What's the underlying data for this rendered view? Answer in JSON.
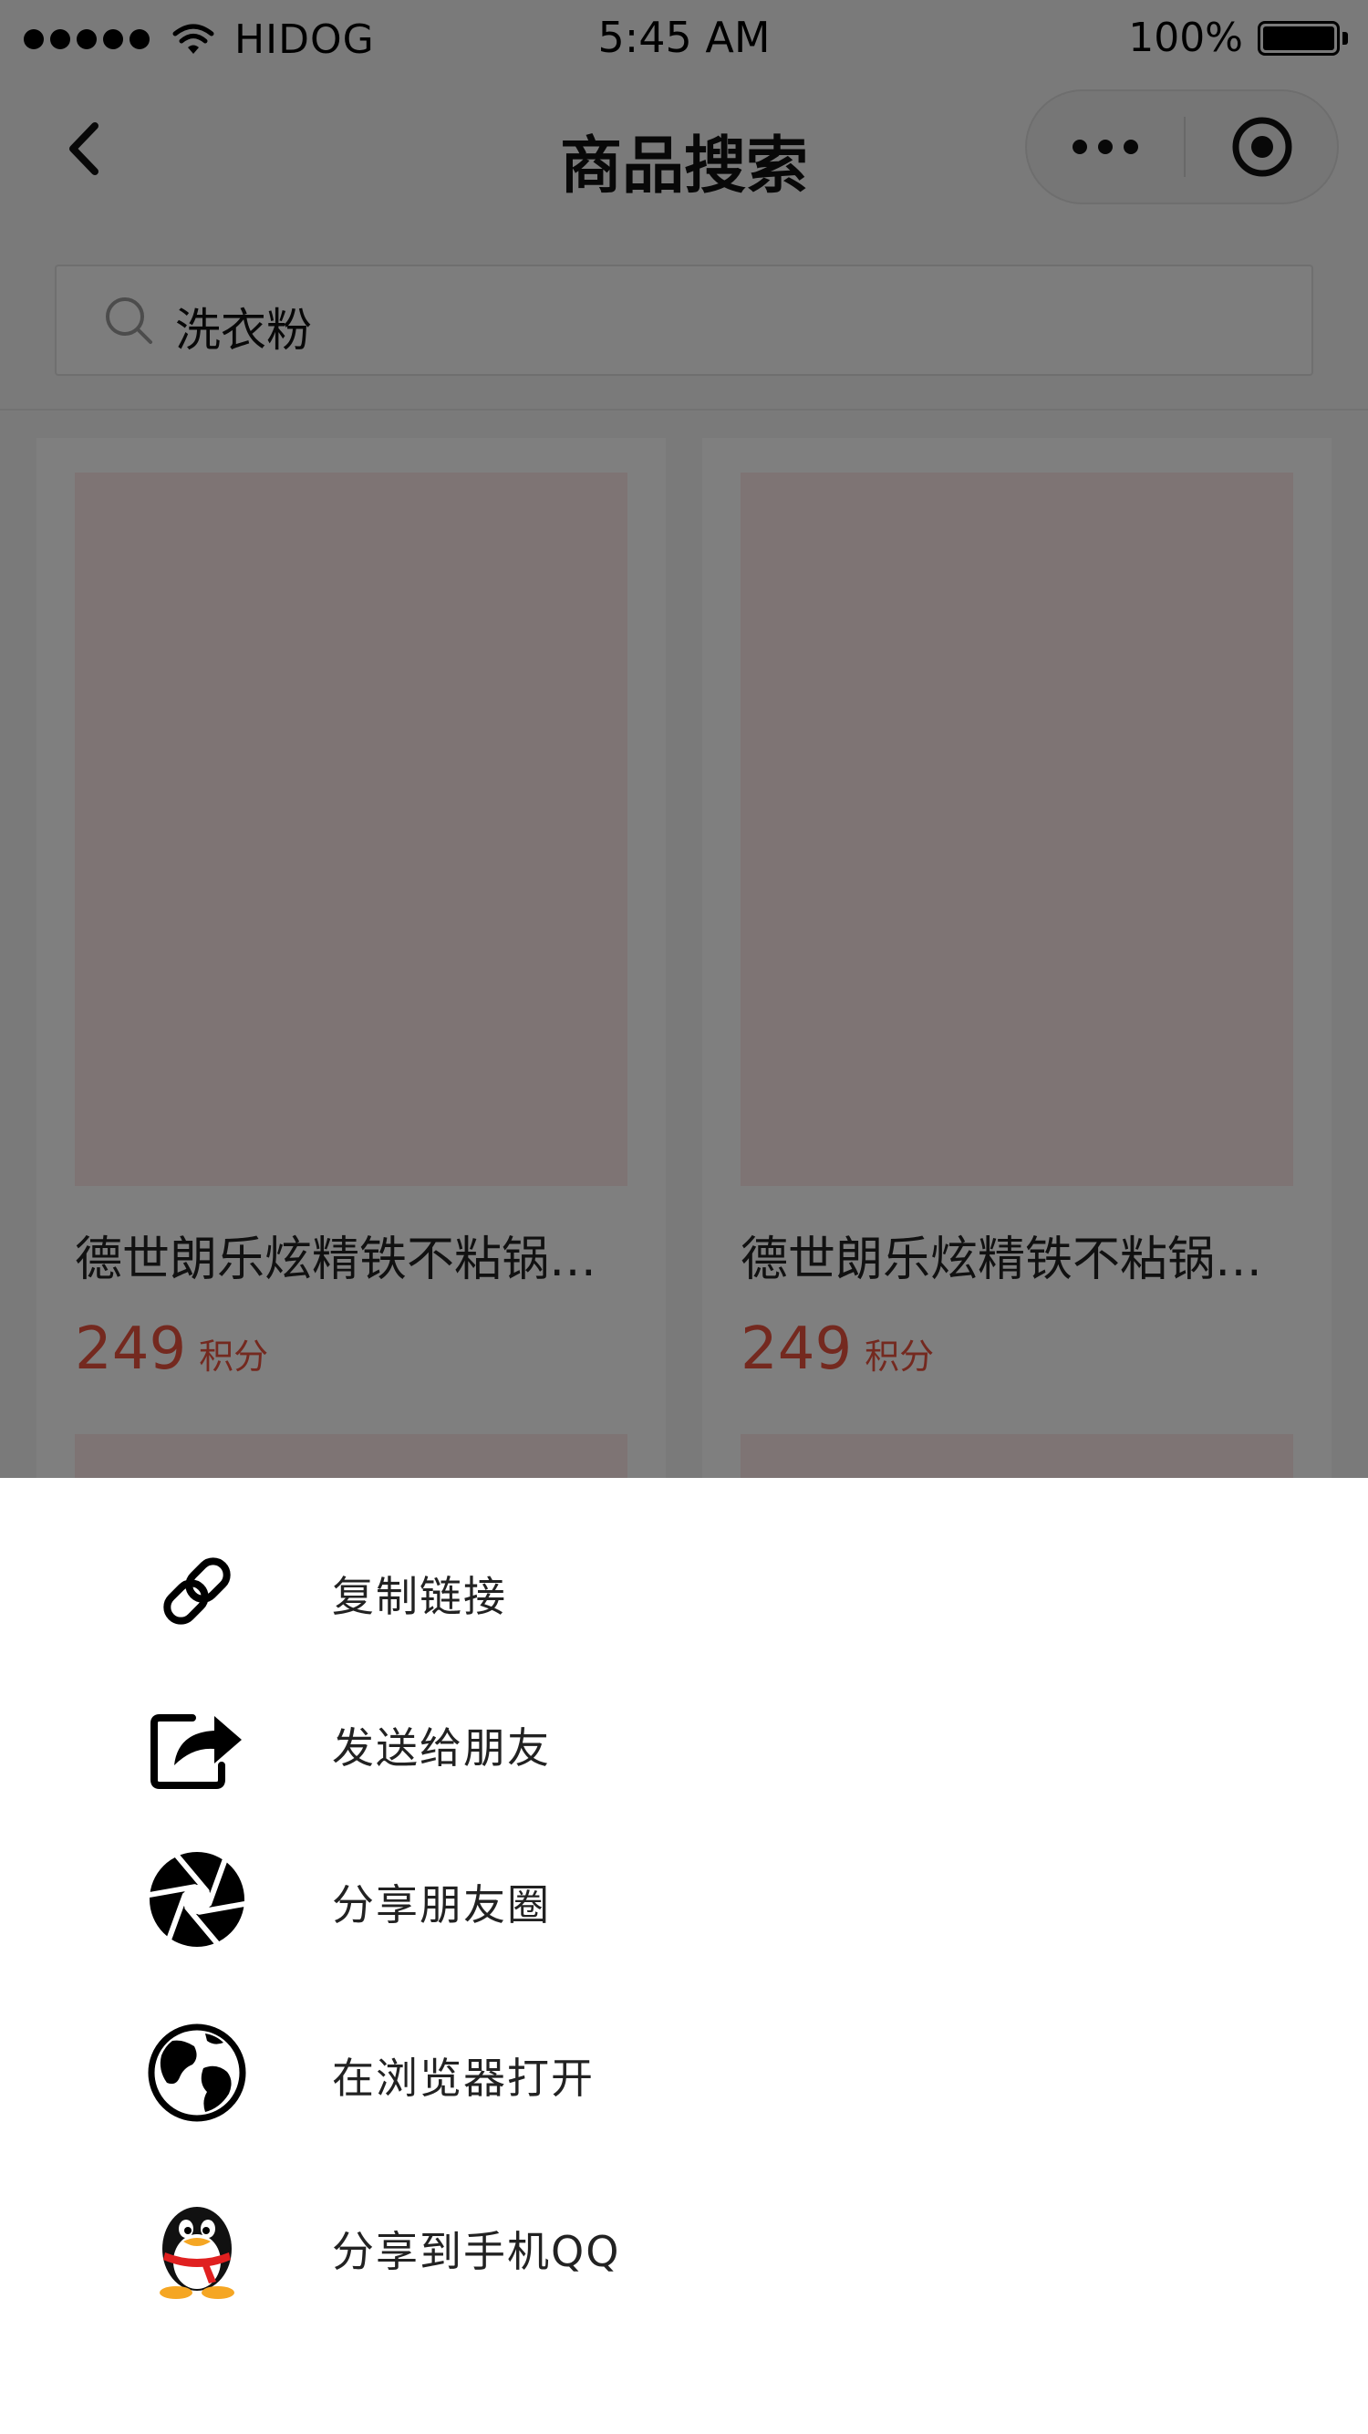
{
  "status_bar": {
    "carrier": "HIDOG",
    "time": "5:45 AM",
    "battery": "100%",
    "icons": [
      "signal-dots-icon",
      "wifi-icon",
      "battery-icon"
    ]
  },
  "nav": {
    "title": "商品搜索",
    "icons": [
      "back-chevron-icon",
      "more-dots-icon",
      "target-close-icon"
    ]
  },
  "search": {
    "value": "洗衣粉",
    "icon": "search-icon"
  },
  "products": [
    {
      "title": "德世朗乐炫精铁不粘锅三...",
      "price": "249",
      "unit": "积分"
    },
    {
      "title": "德世朗乐炫精铁不粘锅三...",
      "price": "249",
      "unit": "积分"
    }
  ],
  "share_sheet": {
    "items": [
      {
        "label": "复制链接",
        "icon": "link-icon"
      },
      {
        "label": "发送给朋友",
        "icon": "share-forward-icon"
      },
      {
        "label": "分享朋友圈",
        "icon": "aperture-moments-icon"
      },
      {
        "label": "在浏览器打开",
        "icon": "globe-icon"
      },
      {
        "label": "分享到手机QQ",
        "icon": "qq-penguin-icon"
      }
    ]
  },
  "colors": {
    "price": "#e8523f",
    "mask": "rgba(0,0,0,0.5)",
    "sheet_bg": "#ffffff"
  }
}
